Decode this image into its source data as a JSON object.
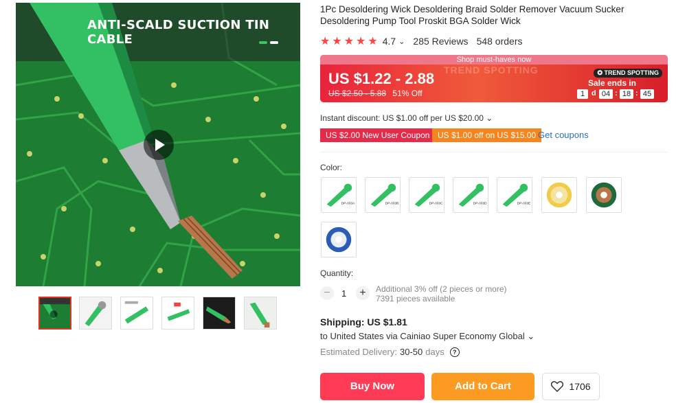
{
  "product": {
    "title": "1Pc Desoldering Wick Desoldering Braid Solder Remover Vacuum Sucker Desoldering Pump Tool Proskit BGA Solder Wick",
    "main_image_banner": "ANTI-SCALD SUCTION TIN CABLE",
    "rating_value": "4.7",
    "rating_chevron": "⌄",
    "reviews": "285 Reviews",
    "orders": "548 orders",
    "stars": 5
  },
  "price": {
    "header": "Shop must-haves now",
    "ghost_text": "TREND SPOTTING",
    "current": "US $1.22 - 2.88",
    "original": "US $2.50 - 5.88",
    "discount": "51% Off",
    "badge": "TREND SPOTTING",
    "sale_ends": "Sale ends in",
    "countdown": {
      "days": "1",
      "d": "d",
      "hours": "04",
      "minutes": "18",
      "seconds": "45",
      "sep": ":"
    }
  },
  "discounts": {
    "instant": "Instant discount: US $1.00 off per US $20.00 ⌄",
    "coupon_new_user": "US $2.00 New User Coupon",
    "coupon_spend": "US $1.00 off on US $15.00",
    "get_coupons": "Get coupons"
  },
  "color": {
    "label": "Color:",
    "swatches": [
      "green-wick-1",
      "green-wick-2",
      "green-wick-3",
      "green-wick-4",
      "green-wick-5",
      "gold-reel",
      "green-reel",
      "blue-reel"
    ],
    "swatch_labels": [
      "DP-033A",
      "DP-033B",
      "DP-033C",
      "DP-033D",
      "DP-033E",
      "",
      ""
    ]
  },
  "quantity": {
    "label": "Quantity:",
    "minus": "−",
    "value": "1",
    "plus": "+",
    "note_line1": "Additional 3% off (2 pieces or more)",
    "note_line2": "7391 pieces available"
  },
  "shipping": {
    "title": "Shipping: US $1.81",
    "destination": "to United States via Cainiao Super Economy Global ⌄",
    "delivery_label": "Estimated Delivery:",
    "delivery_value": "30-50",
    "delivery_unit": "days",
    "help_icon": "?"
  },
  "actions": {
    "buy_now": "Buy Now",
    "add_to_cart": "Add to Cart",
    "wishlist_count": "1706"
  },
  "colors": {
    "accent_red": "#ff3b56",
    "cart_orange": "#fb9b21",
    "star": "#f44",
    "link_blue": "#2a6eb9",
    "coupon_red": "#e42c4a",
    "coupon_orange": "#f5851f"
  }
}
